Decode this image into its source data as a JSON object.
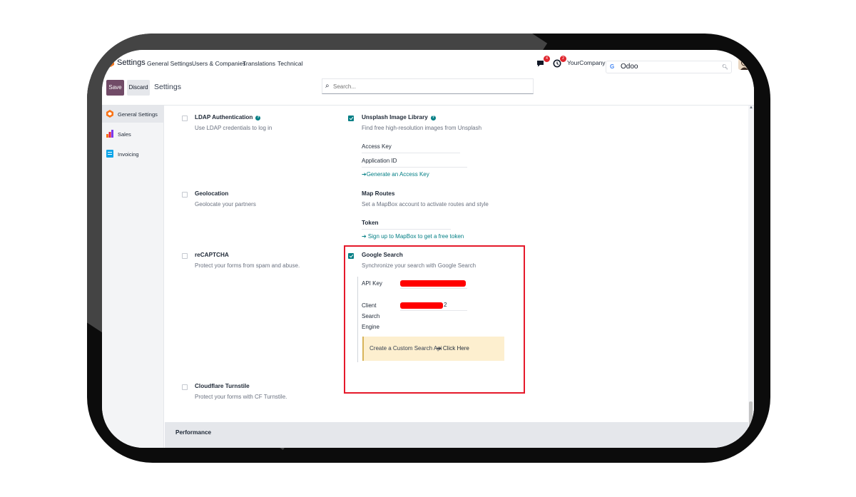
{
  "topnav": {
    "app_name": "Settings",
    "items": [
      "General Settings",
      "Users & Companies",
      "Translations",
      "Technical"
    ],
    "messages_count": "4",
    "activity_count": "2",
    "company": "YourCompany",
    "google_search": {
      "value": "Odoo"
    }
  },
  "controlbar": {
    "save_label": "Save",
    "discard_label": "Discard",
    "title": "Settings",
    "search_placeholder": "Search..."
  },
  "sidebar": {
    "items": [
      {
        "label": "General Settings",
        "active": true
      },
      {
        "label": "Sales",
        "active": false
      },
      {
        "label": "Invoicing",
        "active": false
      }
    ]
  },
  "settings": {
    "ldap": {
      "title": "LDAP Authentication",
      "desc": "Use LDAP credentials to log in",
      "checked": false
    },
    "unsplash": {
      "title": "Unsplash Image Library",
      "desc": "Find free high-resolution images from Unsplash",
      "checked": true,
      "access_key_label": "Access Key",
      "application_id_label": "Application ID",
      "link": "➔Generate an Access Key"
    },
    "geolocation": {
      "title": "Geolocation",
      "desc": "Geolocate your partners",
      "checked": false
    },
    "map_routes": {
      "title": "Map Routes",
      "desc": "Set a MapBox account to activate routes and style",
      "token_label": "Token",
      "link": "➔ Sign up to MapBox to get a free token"
    },
    "recaptcha": {
      "title": "reCAPTCHA",
      "desc": "Protect your forms from spam and abuse.",
      "checked": false
    },
    "google_search": {
      "title": "Google Search",
      "desc": "Synchronize your search with Google Search",
      "checked": true,
      "api_key_label": "API Key",
      "client_label_1": "Client",
      "client_label_2": "Search",
      "client_label_3": "Engine",
      "client_value_suffix": "2",
      "alert_text": "Create a Custom Search Api",
      "alert_link": "➔ Click Here"
    },
    "cloudflare": {
      "title": "Cloudflare Turnstile",
      "desc": "Protect your forms with CF Turnstile.",
      "checked": false
    }
  },
  "performance": {
    "label": "Performance"
  },
  "colors": {
    "brand": "#714b67",
    "accent": "#017e84",
    "highlight": "#e5192a",
    "redaction": "#ff0000"
  }
}
